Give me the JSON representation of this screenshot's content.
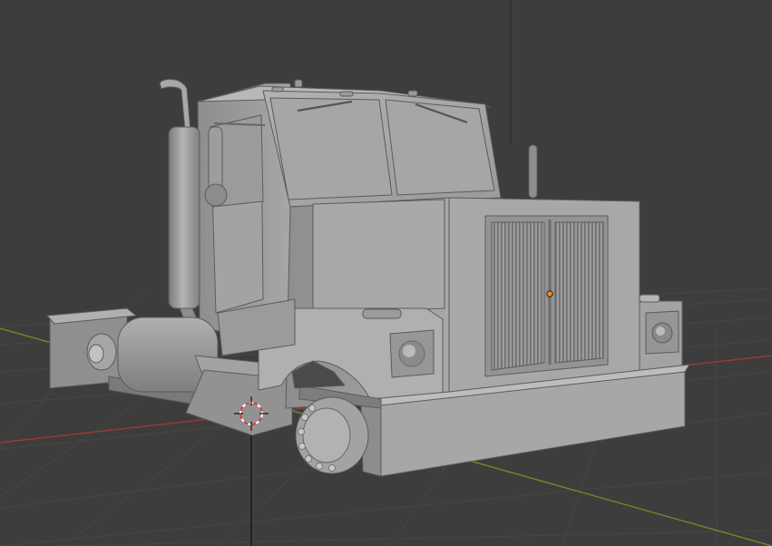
{
  "viewport": {
    "mode": "3d-viewport",
    "shading": "solid",
    "object": "semi-truck-cab",
    "colors": {
      "background": "#3d3d3d",
      "grid": "#474747",
      "axis_x": "#9a3a3a",
      "axis_y": "#6f8a2a",
      "body": "#a0a0a0",
      "body_dark": "#7c7c7c",
      "body_light": "#b4b4b4",
      "edge": "#5a5a5a",
      "origin": "#f08a1a",
      "cursor_red": "#e03a3a"
    },
    "icons": [
      "3d-cursor-icon",
      "object-origin-icon"
    ]
  }
}
